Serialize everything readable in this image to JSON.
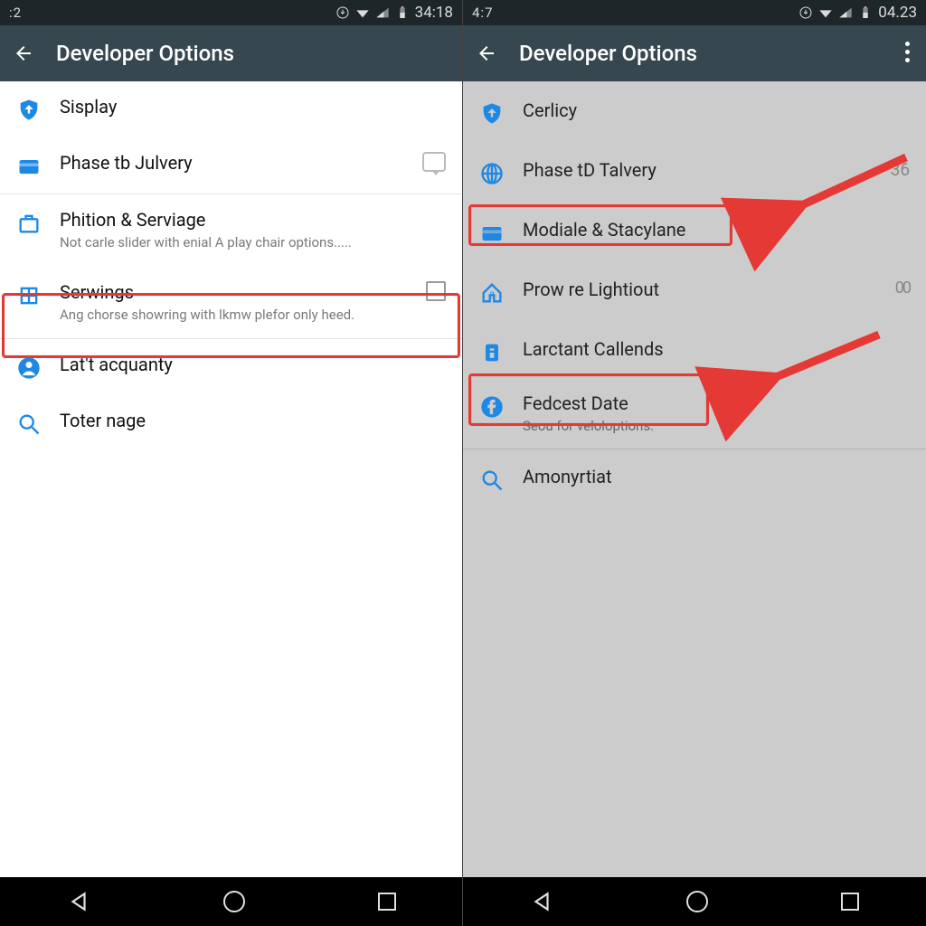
{
  "colors": {
    "accent": "#1e88e5",
    "highlight": "#e53935",
    "actionbar": "#37474f"
  },
  "left": {
    "status": {
      "left": ":2",
      "time": "34:18"
    },
    "title": "Developer Options",
    "items": [
      {
        "icon": "shield-up",
        "title": "Sisplay"
      },
      {
        "icon": "card",
        "title": "Phase tb Julvery",
        "right": "bubble"
      },
      {
        "icon": "briefcase",
        "title": "Phition & Serviage",
        "sub": "Not carle slider with enial A play chair options....."
      },
      {
        "icon": "grid",
        "title": "Serwings",
        "sub": "Ang chorse showring with lkmw plefor only heed.",
        "right": "checkbox",
        "highlighted": true
      },
      {
        "icon": "person",
        "title": "Lat't acquanty"
      },
      {
        "icon": "search",
        "title": "Toter nage"
      }
    ]
  },
  "right": {
    "status": {
      "left": "4:7",
      "time": "04.23"
    },
    "title": "Developer Options",
    "has_more": true,
    "items": [
      {
        "icon": "shield-up",
        "title": "Cerlicy"
      },
      {
        "icon": "globe",
        "title": "Phase tD Talvery",
        "count": "36"
      },
      {
        "icon": "card",
        "title": "Modiale & Stacylane",
        "highlighted": true,
        "arrow": true
      },
      {
        "icon": "house",
        "title": "Prow re Lightiout",
        "toggle": "00"
      },
      {
        "icon": "info",
        "title": "Larctant Callends"
      },
      {
        "icon": "facebook",
        "title": "Fedcest Date",
        "sub": "Seou for veloloptions.",
        "highlighted": true,
        "arrow": true
      },
      {
        "icon": "search",
        "title": "Amonyrtiat"
      }
    ]
  }
}
